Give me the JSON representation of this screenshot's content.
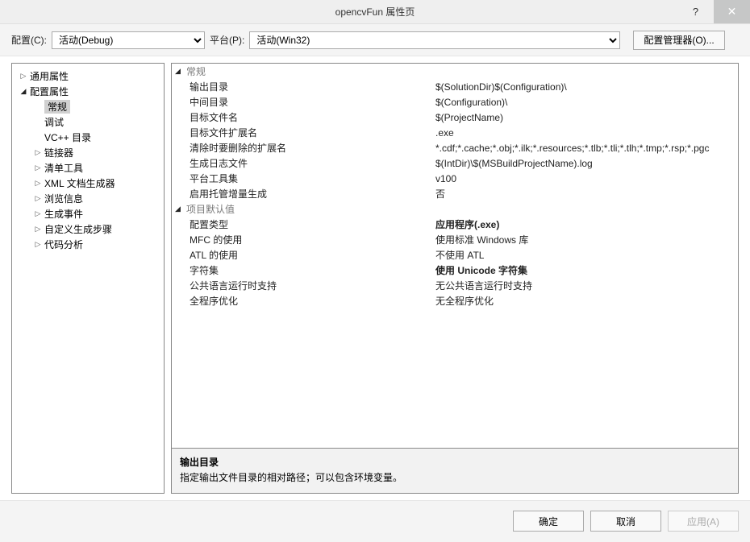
{
  "window": {
    "title": "opencvFun 属性页",
    "help_icon": "?",
    "close_icon": "✕"
  },
  "toolbar": {
    "config_label": "配置(C):",
    "config_value": "活动(Debug)",
    "platform_label": "平台(P):",
    "platform_value": "活动(Win32)",
    "config_manager": "配置管理器(O)..."
  },
  "tree": {
    "items": [
      {
        "label": "通用属性",
        "depth": 0,
        "arrow": "closed"
      },
      {
        "label": "配置属性",
        "depth": 0,
        "arrow": "open"
      },
      {
        "label": "常规",
        "depth": 1,
        "arrow": "none",
        "selected": true
      },
      {
        "label": "调试",
        "depth": 1,
        "arrow": "none"
      },
      {
        "label": "VC++ 目录",
        "depth": 1,
        "arrow": "none"
      },
      {
        "label": "链接器",
        "depth": 1,
        "arrow": "closed"
      },
      {
        "label": "清单工具",
        "depth": 1,
        "arrow": "closed"
      },
      {
        "label": "XML 文档生成器",
        "depth": 1,
        "arrow": "closed"
      },
      {
        "label": "浏览信息",
        "depth": 1,
        "arrow": "closed"
      },
      {
        "label": "生成事件",
        "depth": 1,
        "arrow": "closed"
      },
      {
        "label": "自定义生成步骤",
        "depth": 1,
        "arrow": "closed"
      },
      {
        "label": "代码分析",
        "depth": 1,
        "arrow": "closed"
      }
    ]
  },
  "props": {
    "groups": [
      {
        "name": "常规",
        "rows": [
          {
            "name": "输出目录",
            "value": "$(SolutionDir)$(Configuration)\\",
            "bold": false
          },
          {
            "name": "中间目录",
            "value": "$(Configuration)\\",
            "bold": false
          },
          {
            "name": "目标文件名",
            "value": "$(ProjectName)",
            "bold": false
          },
          {
            "name": "目标文件扩展名",
            "value": ".exe",
            "bold": false
          },
          {
            "name": "清除时要删除的扩展名",
            "value": "*.cdf;*.cache;*.obj;*.ilk;*.resources;*.tlb;*.tli;*.tlh;*.tmp;*.rsp;*.pgc",
            "bold": false
          },
          {
            "name": "生成日志文件",
            "value": "$(IntDir)\\$(MSBuildProjectName).log",
            "bold": false
          },
          {
            "name": "平台工具集",
            "value": "v100",
            "bold": false
          },
          {
            "name": "启用托管增量生成",
            "value": "否",
            "bold": false
          }
        ]
      },
      {
        "name": "项目默认值",
        "rows": [
          {
            "name": "配置类型",
            "value": "应用程序(.exe)",
            "bold": true
          },
          {
            "name": "MFC 的使用",
            "value": "使用标准 Windows 库",
            "bold": false
          },
          {
            "name": "ATL 的使用",
            "value": "不使用 ATL",
            "bold": false
          },
          {
            "name": "字符集",
            "value": "使用 Unicode 字符集",
            "bold": true
          },
          {
            "name": "公共语言运行时支持",
            "value": "无公共语言运行时支持",
            "bold": false
          },
          {
            "name": "全程序优化",
            "value": "无全程序优化",
            "bold": false
          }
        ]
      }
    ]
  },
  "description": {
    "title": "输出目录",
    "text": "指定输出文件目录的相对路径；可以包含环境变量。"
  },
  "buttons": {
    "ok": "确定",
    "cancel": "取消",
    "apply": "应用(A)"
  }
}
